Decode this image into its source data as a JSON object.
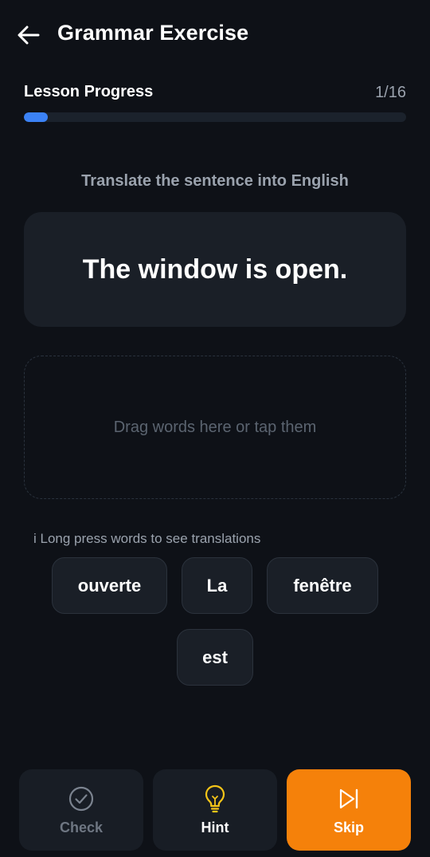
{
  "header": {
    "title": "Grammar Exercise"
  },
  "progress": {
    "label": "Lesson Progress",
    "count": "1/16",
    "current": 1,
    "total": 16
  },
  "exercise": {
    "instruction": "Translate the sentence into English",
    "sentence": "The window is open.",
    "drop_hint": "Drag words here or tap them",
    "tip": "i Long press words to see translations",
    "words": [
      "ouverte",
      "La",
      "fenêtre",
      "est"
    ]
  },
  "actions": {
    "check": "Check",
    "hint": "Hint",
    "skip": "Skip"
  },
  "colors": {
    "accent": "#3b82f6",
    "skip": "#f5810a",
    "hint_icon": "#f5c518"
  }
}
